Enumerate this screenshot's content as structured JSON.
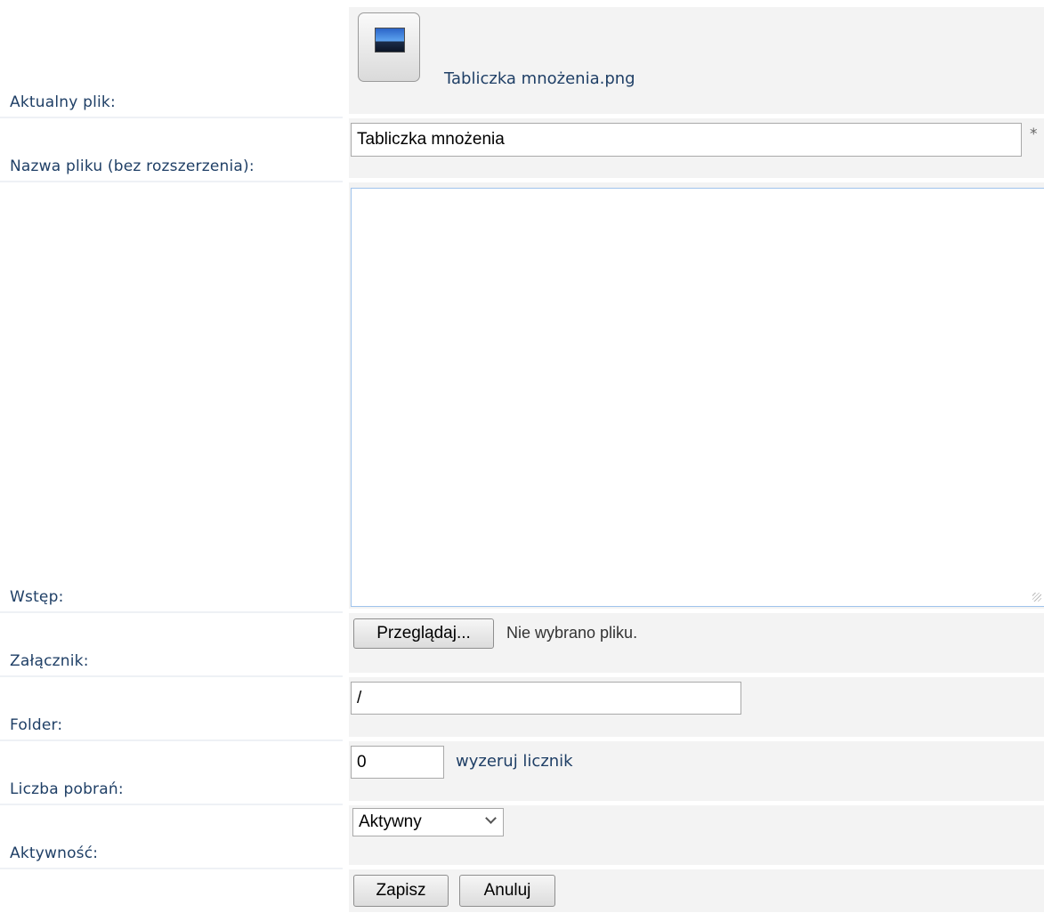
{
  "form": {
    "current_file": {
      "label": "Aktualny plik:",
      "filename": "Tabliczka mnożenia.png",
      "icon": "image-file-icon"
    },
    "filename_field": {
      "label": "Nazwa pliku (bez rozszerzenia):",
      "value": "Tabliczka mnożenia",
      "required_marker": "*"
    },
    "intro": {
      "label": "Wstęp:",
      "value": ""
    },
    "attachment": {
      "label": "Załącznik:",
      "browse_button": "Przeglądaj...",
      "no_file_text": "Nie wybrano pliku."
    },
    "folder": {
      "label": "Folder:",
      "value": "/"
    },
    "downloads": {
      "label": "Liczba pobrań:",
      "value": "0",
      "reset_link": "wyzeruj licznik"
    },
    "activity": {
      "label": "Aktywność:",
      "selected": "Aktywny",
      "options": [
        "Aktywny"
      ]
    },
    "actions": {
      "save": "Zapisz",
      "cancel": "Anuluj"
    }
  },
  "colors": {
    "label_text": "#1f3f66",
    "field_bg": "#f3f3f3",
    "focus_border": "#9fc3ec"
  }
}
